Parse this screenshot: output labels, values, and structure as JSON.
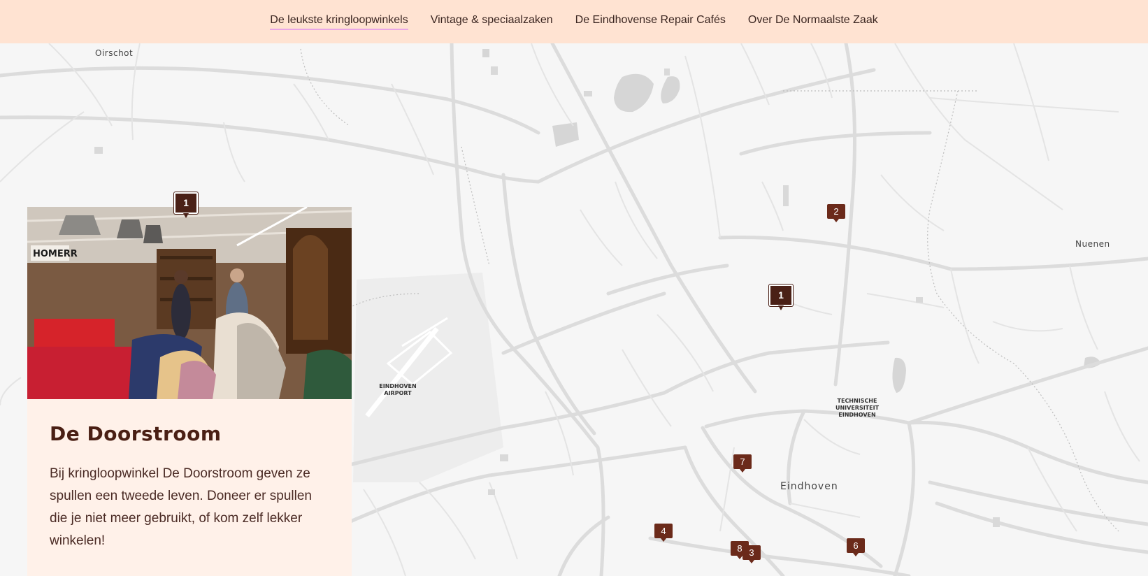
{
  "nav": {
    "items": [
      {
        "label": "De leukste kringloopwinkels",
        "active": true
      },
      {
        "label": "Vintage & speciaalzaken",
        "active": false
      },
      {
        "label": "De Eindhovense Repair Cafés",
        "active": false
      },
      {
        "label": "Over De Normaalste Zaak",
        "active": false
      }
    ]
  },
  "map": {
    "labels": {
      "oirschot": "Oirschot",
      "nuenen": "Nuenen",
      "eindhoven": "Eindhoven",
      "airport": "EINDHOVEN\nAIRPORT",
      "tue": "TECHNISCHE\nUNIVERSITEIT\nEINDHOVEN"
    },
    "markers": {
      "m1": "1",
      "m2": "2",
      "m3": "3",
      "m4": "4",
      "m6": "6",
      "m7": "7",
      "m8": "8"
    }
  },
  "card": {
    "marker": "1",
    "title": "De Doorstroom",
    "description": "Bij kringloopwinkel De Doorstroom geven ze spullen een tweede leven. Doneer er spullen die je niet meer gebruikt, of kom zelf lekker winkelen!",
    "photo_sign": "HOMERR"
  },
  "colors": {
    "nav_bg": "#ffe3d2",
    "nav_active_underline": "#e8a6e6",
    "marker": "#6b2a1a",
    "card_bg": "#fff1e9",
    "title": "#4a1f14"
  }
}
